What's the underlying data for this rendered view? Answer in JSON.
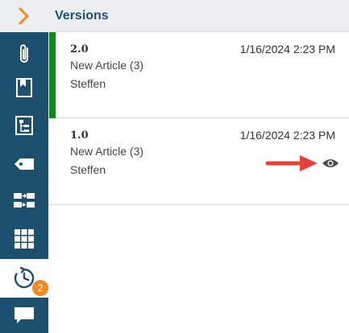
{
  "panel": {
    "title": "Versions"
  },
  "sidebar": {
    "toggle_icon": "chevron-right-icon",
    "items": [
      {
        "icon": "paperclip-icon"
      },
      {
        "icon": "bookmark-icon"
      },
      {
        "icon": "structure-icon"
      },
      {
        "icon": "tag-icon"
      },
      {
        "icon": "transfer-icon"
      },
      {
        "icon": "grid-icon"
      },
      {
        "icon": "history-icon",
        "active": true,
        "badge": "2"
      },
      {
        "icon": "comment-icon"
      }
    ],
    "colors": {
      "background": "#1d4f6e",
      "toggle_accent": "#f08a24",
      "badge": "#f08a24"
    }
  },
  "versions": [
    {
      "number": "2.0",
      "date": "1/16/2024 2:23 PM",
      "title": "New Article (3)",
      "author": "Steffen",
      "current": true
    },
    {
      "number": "1.0",
      "date": "1/16/2024 2:23 PM",
      "title": "New Article (3)",
      "author": "Steffen",
      "current": false,
      "action_icon": "eye-icon"
    }
  ],
  "colors": {
    "current_indicator": "#108c18",
    "annotation_arrow": "#e8403a"
  }
}
